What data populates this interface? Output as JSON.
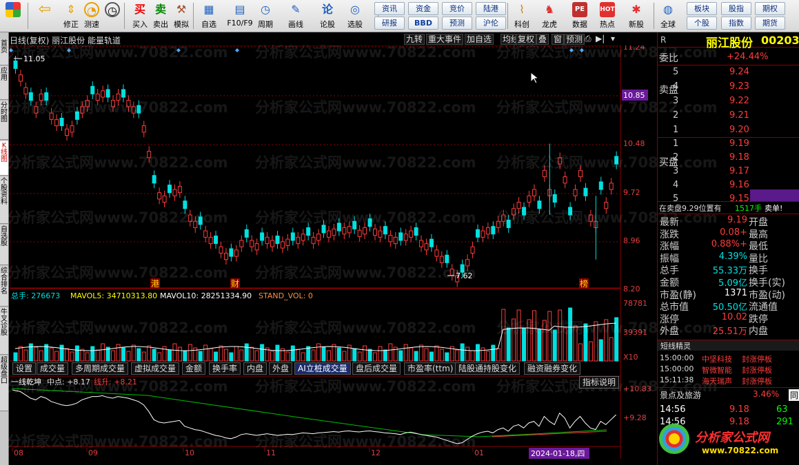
{
  "toolbar": {
    "buttons": [
      {
        "id": "home",
        "label": "",
        "icon": "windows-logo-icon"
      },
      {
        "id": "back",
        "label": "",
        "icon": "back-arrow-icon"
      },
      {
        "id": "fix",
        "label": "修正",
        "icon": "up-down-arrow-icon"
      },
      {
        "id": "speed",
        "label": "测速",
        "icon": "speed-icon"
      },
      {
        "id": "clock",
        "label": "",
        "icon": "clock-icon"
      },
      {
        "id": "buy",
        "label": "买入",
        "icon": "buy-icon",
        "glyph": "买"
      },
      {
        "id": "sell",
        "label": "卖出",
        "icon": "sell-icon",
        "glyph": "卖"
      },
      {
        "id": "sim",
        "label": "模拟",
        "icon": "hammer-icon"
      },
      {
        "id": "watch",
        "label": "自选",
        "icon": "watchlist-icon"
      },
      {
        "id": "f10",
        "label": "F10/F9",
        "icon": "f10-icon"
      },
      {
        "id": "period",
        "label": "周期",
        "icon": "period-icon"
      },
      {
        "id": "draw",
        "label": "画线",
        "icon": "pencil-icon"
      },
      {
        "id": "talk",
        "label": "论股",
        "icon": "discuss-icon",
        "glyph": "论"
      },
      {
        "id": "pick",
        "label": "选股",
        "icon": "stock-pick-icon"
      },
      {
        "id": "sci",
        "label": "科创",
        "icon": "kechuang-icon"
      },
      {
        "id": "dragon",
        "label": "龙虎",
        "icon": "dragon-tiger-icon"
      },
      {
        "id": "data",
        "label": "数据",
        "icon": "data-icon",
        "glyph": "PE"
      },
      {
        "id": "hot",
        "label": "热点",
        "icon": "hot-icon",
        "glyph": "HOT"
      },
      {
        "id": "new",
        "label": "新股",
        "icon": "new-stock-icon"
      },
      {
        "id": "global",
        "label": "全球",
        "icon": "globe-icon"
      }
    ],
    "small_buttons": [
      {
        "label": "资讯",
        "bold": false
      },
      {
        "label": "研报",
        "bold": false
      },
      {
        "label": "资金",
        "bold": false
      },
      {
        "label": "BBD",
        "bold": true
      },
      {
        "label": "竞价",
        "bold": false
      },
      {
        "label": "预测",
        "bold": false
      },
      {
        "label": "陆港",
        "bold": false
      },
      {
        "label": "沪伦",
        "bold": false
      },
      {
        "label": "板块",
        "bold": false
      },
      {
        "label": "个股",
        "bold": false
      },
      {
        "label": "股指",
        "bold": false
      },
      {
        "label": "指数",
        "bold": false
      },
      {
        "label": "期权",
        "bold": false
      },
      {
        "label": "期货",
        "bold": false
      }
    ]
  },
  "sidetabs": [
    "首页",
    "应用",
    "分时图",
    "K线图",
    "个股资料",
    "自选股",
    "综合排名",
    "牛叉诊股",
    "超级盘口"
  ],
  "chart_header": {
    "title": "日线(复权)  丽江股份  能量轨道",
    "buttons": [
      "九转",
      "重大事件",
      "加自选",
      "均线",
      "复权",
      "叠",
      "窗",
      "预测"
    ]
  },
  "price_axis": [
    "11.24",
    "10.85",
    "10.48",
    "9.72",
    "8.96",
    "8.20"
  ],
  "price_axis_highlight": "10.85",
  "annotations": {
    "high": "11.05",
    "low": "7.62",
    "event_labels": [
      "港",
      "财",
      "榜"
    ]
  },
  "volume": {
    "header": [
      {
        "text": "总手: 276673",
        "color": "#00e0e0"
      },
      {
        "text": "MAVOL5: 34710313.80",
        "color": "#ffff00"
      },
      {
        "text": "MAVOL10: 28251334.90",
        "color": "#ffffff"
      },
      {
        "text": "STAND_VOL: 0",
        "color": "#ff9040"
      }
    ],
    "axis": [
      "78781",
      "39391",
      "X10"
    ]
  },
  "indicator_tabs": [
    "设置",
    "成交量",
    "多周期成交量",
    "虚拟成交量",
    "金额",
    "换手率",
    "内盘",
    "外盘",
    "AI立桩成交量",
    "盘后成交量",
    "市盈率(ttm)",
    "陆股通持股变化",
    "融资融券变化"
  ],
  "indicator_tab_active": "AI立桩成交量",
  "indicator_help": "指标说明",
  "lower": {
    "name": "一线乾坤",
    "midpoint": "中点: +8.17",
    "line": "线升: +8.21",
    "axis": [
      "+10.83",
      "+9.28"
    ]
  },
  "date_axis": {
    "labels": [
      "08",
      "09",
      "10",
      "11",
      "12",
      "01"
    ],
    "cursor_date": "2024-01-18,四"
  },
  "watermark": "分析家公式网www.70822.com",
  "quote": {
    "name": "丽江股份",
    "code": "00203",
    "r": "R",
    "weibi_label": "委比",
    "weibi": "+24.44%",
    "sell_label": "卖盘",
    "buy_label": "买盘",
    "sells": [
      {
        "n": "5",
        "p": "9.24"
      },
      {
        "n": "4",
        "p": "9.23"
      },
      {
        "n": "3",
        "p": "9.22"
      },
      {
        "n": "2",
        "p": "9.21"
      },
      {
        "n": "1",
        "p": "9.20"
      }
    ],
    "buys": [
      {
        "n": "1",
        "p": "9.19"
      },
      {
        "n": "2",
        "p": "9.18"
      },
      {
        "n": "3",
        "p": "9.17"
      },
      {
        "n": "4",
        "p": "9.16"
      },
      {
        "n": "5",
        "p": "9.15"
      }
    ],
    "notice": "在卖盘9.29位置有",
    "notice_qty": "1517手",
    "notice_tail": "卖单!",
    "stats": [
      {
        "l": "最新",
        "v": "9.19",
        "c": "red",
        "r": "开盘"
      },
      {
        "l": "涨跌",
        "v": "+0.08",
        "c": "red",
        "r": "最高"
      },
      {
        "l": "涨幅",
        "v": "+0.88%",
        "c": "red",
        "r": "最低"
      },
      {
        "l": "振幅",
        "v": "4.39%",
        "c": "cyan",
        "r": "量比"
      },
      {
        "l": "总手",
        "v": "55.33万",
        "c": "cyan",
        "r": "换手"
      },
      {
        "l": "金额",
        "v": "5.09亿",
        "c": "cyan",
        "r": "换手(实)"
      },
      {
        "l": "市盈(静)",
        "v": "1371",
        "c": "white",
        "r": "市盈(动)"
      },
      {
        "l": "总市值",
        "v": "50.50亿",
        "c": "cyan",
        "r": "流通值"
      },
      {
        "l": "涨停",
        "v": "10.02",
        "c": "red",
        "r": "跌停"
      },
      {
        "l": "外盘",
        "v": "25.51万",
        "c": "red",
        "r": "内盘"
      }
    ],
    "sprite_title": "短线精灵",
    "sprite": [
      {
        "t": "15:00:00",
        "n": "中坚科技",
        "e": "封涨停板"
      },
      {
        "t": "15:00:00",
        "n": "智微智能",
        "e": "封涨停板"
      },
      {
        "t": "15:11:38",
        "n": "海天瑞声",
        "e": "封涨停板"
      }
    ],
    "sector": "景点及旅游",
    "sector_pct": "3.46%",
    "sector_tail": "同",
    "ticks": [
      {
        "t": "14:56",
        "p": "9.18",
        "v": "63"
      },
      {
        "t": "14:56",
        "p": "9.18",
        "v": "291"
      }
    ],
    "brand": "分析家公式网",
    "brand_url": "www.70822.com"
  },
  "colors": {
    "up": "#ff3c3c",
    "down": "#00e0e0",
    "bg": "#000000",
    "grid": "#8b0000",
    "ma": "#ffffff",
    "ma2": "#00c000"
  }
}
